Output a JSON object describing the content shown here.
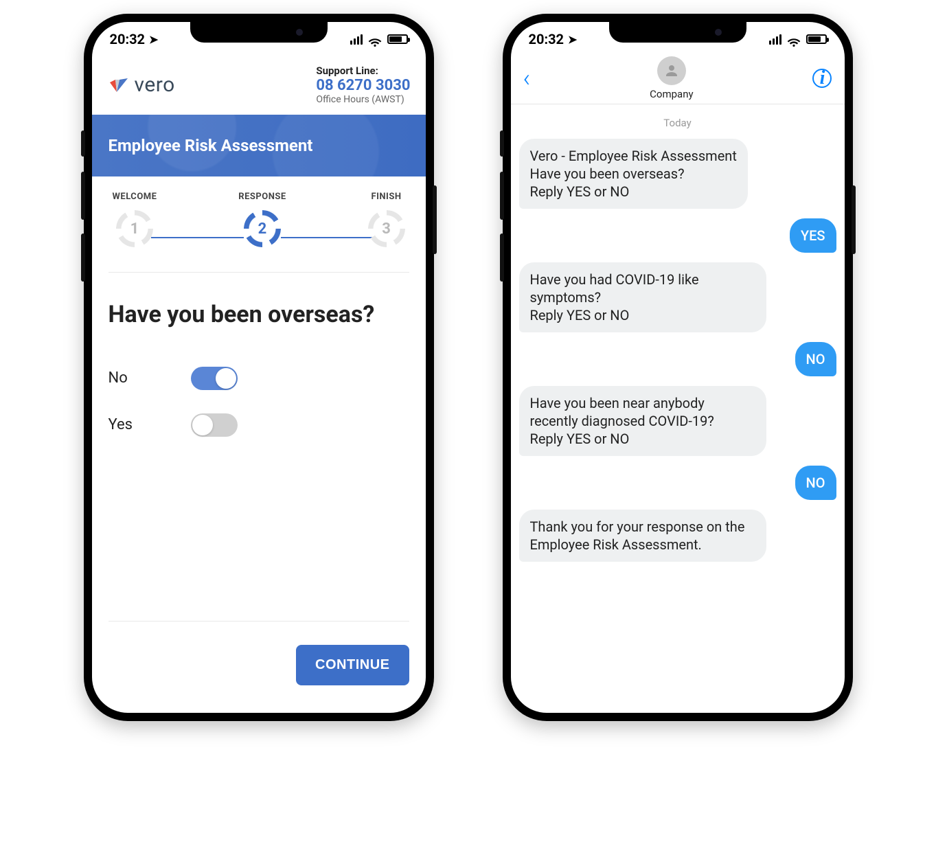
{
  "status": {
    "time": "20:32"
  },
  "app": {
    "brand_name": "vero",
    "support_heading": "Support Line:",
    "support_phone": "08 6270 3030",
    "support_hours": "Office Hours (AWST)",
    "hero_title": "Employee Risk Assessment",
    "steps": [
      {
        "label": "WELCOME",
        "number": "1",
        "active": false
      },
      {
        "label": "RESPONSE",
        "number": "2",
        "active": true
      },
      {
        "label": "FINISH",
        "number": "3",
        "active": false
      }
    ],
    "question": "Have you been overseas?",
    "options": [
      {
        "label": "No",
        "on": true
      },
      {
        "label": "Yes",
        "on": false
      }
    ],
    "continue_label": "CONTINUE"
  },
  "messages": {
    "contact_name": "Company",
    "date_label": "Today",
    "thread": [
      {
        "dir": "in",
        "text": "Vero - Employee Risk Assessment\nHave you been overseas?\nReply YES or NO"
      },
      {
        "dir": "out",
        "text": "YES"
      },
      {
        "dir": "in",
        "text": "Have you had COVID-19 like symptoms?\nReply YES or NO"
      },
      {
        "dir": "out",
        "text": "NO"
      },
      {
        "dir": "in",
        "text": "Have you been near anybody recently diagnosed COVID-19?\nReply YES or NO"
      },
      {
        "dir": "out",
        "text": "NO"
      },
      {
        "dir": "in",
        "text": "Thank you for your response on the Employee Risk Assessment."
      }
    ]
  }
}
